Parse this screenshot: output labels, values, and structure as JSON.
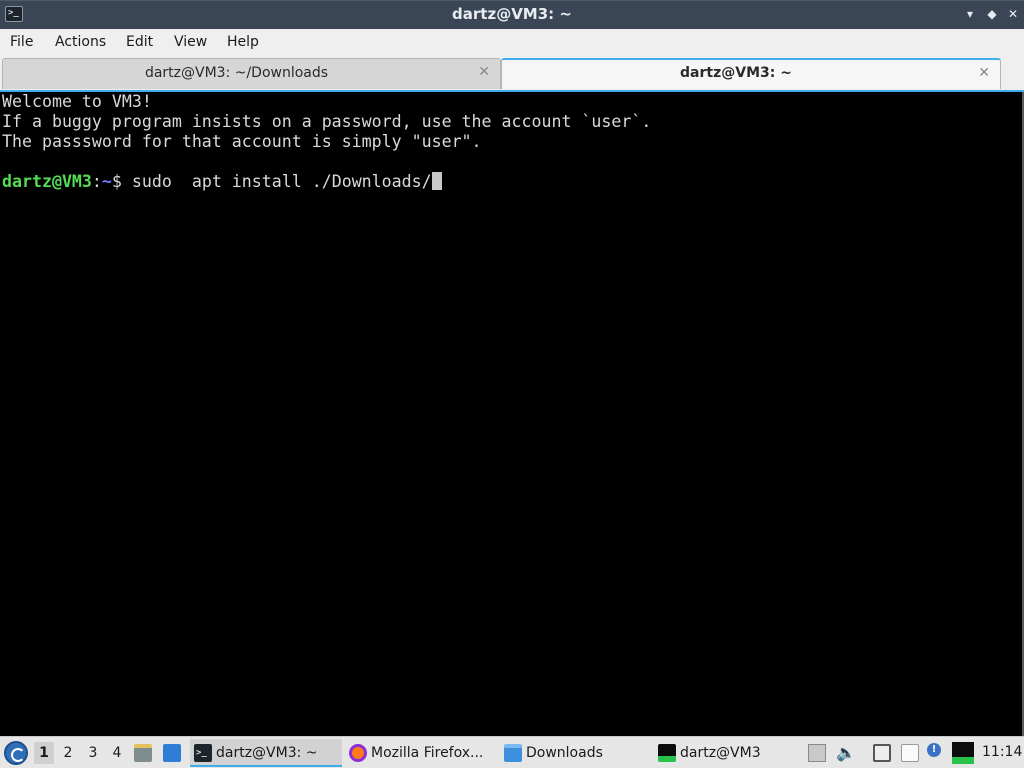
{
  "window": {
    "title": "dartz@VM3: ~",
    "app_icon": "terminal-icon",
    "controls": {
      "minimize": "▾",
      "maximize": "◆",
      "close": "✕"
    }
  },
  "menubar": {
    "items": [
      "File",
      "Actions",
      "Edit",
      "View",
      "Help"
    ]
  },
  "tabs": [
    {
      "label": "dartz@VM3: ~/Downloads",
      "active": false,
      "close": "✕"
    },
    {
      "label": "dartz@VM3: ~",
      "active": true,
      "close": "✕"
    }
  ],
  "terminal": {
    "lines": [
      "Welcome to VM3!",
      "If a buggy program insists on a password, use the account `user`.",
      "The passsword for that account is simply \"user\".",
      ""
    ],
    "prompt": {
      "user_host": "dartz@VM3",
      "separator": ":",
      "path": "~",
      "symbol": "$ ",
      "command": "sudo  apt install ./Downloads/"
    },
    "colors": {
      "user": "#55dc55",
      "path": "#6a7cff",
      "text": "#d9d9d9",
      "background": "#000000"
    }
  },
  "taskbar": {
    "start_icon": "start-menu-icon",
    "workspaces": [
      "1",
      "2",
      "3",
      "4"
    ],
    "current_workspace": "1",
    "tasks": [
      {
        "label": "dartz@VM3: ~",
        "icon": "terminal-icon",
        "active": true
      },
      {
        "label": "Mozilla Firefox...",
        "icon": "firefox-icon",
        "active": false
      },
      {
        "label": "Downloads",
        "icon": "folder-icon",
        "active": false
      },
      {
        "label": "dartz@VM3",
        "icon": "system-monitor-icon",
        "active": false
      }
    ],
    "tray": {
      "volume_glyph": "🔈",
      "info_glyph": "!"
    },
    "clock": "11:14"
  }
}
